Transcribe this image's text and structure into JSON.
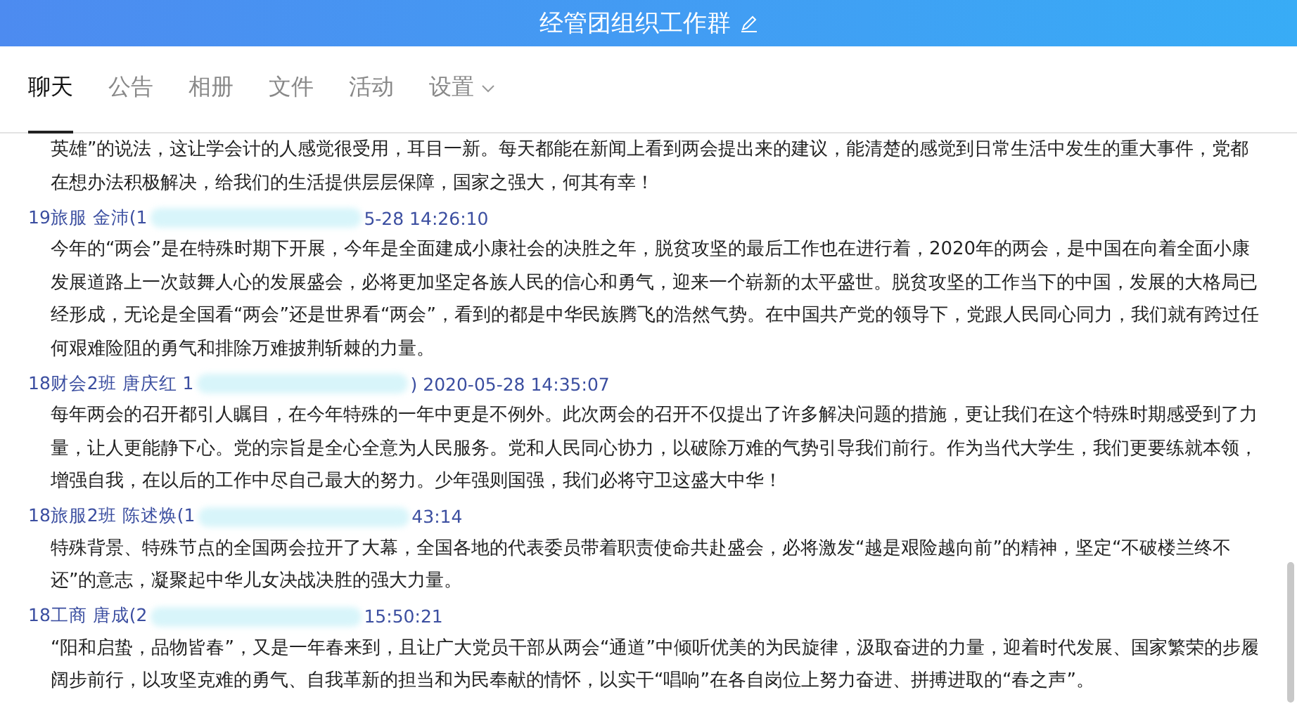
{
  "window": {
    "title": "经管团组织工作群"
  },
  "tabs": [
    {
      "label": "聊天",
      "selected": true
    },
    {
      "label": "公告",
      "selected": false
    },
    {
      "label": "相册",
      "selected": false
    },
    {
      "label": "文件",
      "selected": false
    },
    {
      "label": "活动",
      "selected": false
    },
    {
      "label": "设置",
      "selected": false,
      "kind": "dropdown"
    }
  ],
  "messages": [
    {
      "text": "英雄”的说法，这让学会计的人感觉很受用，耳目一新。每天都能在新闻上看到两会提出来的建议，能清楚的感觉到日常生活中发生的重大事件，党都在想办法积极解决，给我们的生活提供层层保障，国家之强大，何其有幸！"
    },
    {
      "sender": "19旅服 金沛(1",
      "time": "5-28 14:26:10",
      "text": "今年的“两会”是在特殊时期下开展，今年是全面建成小康社会的决胜之年，脱贫攻坚的最后工作也在进行着，2020年的两会，是中国在向着全面小康发展道路上一次鼓舞人心的发展盛会，必将更加坚定各族人民的信心和勇气，迎来一个崭新的太平盛世。脱贫攻坚的工作当下的中国，发展的大格局已经形成，无论是全国看“两会”还是世界看“两会”，看到的都是中华民族腾飞的浩然气势。在中国共产党的领导下，党跟人民同心同力，我们就有跨过任何艰难险阻的勇气和排除万难披荆斩棘的力量。"
    },
    {
      "sender": "18财会2班 唐庆红  1",
      "time": ") 2020-05-28 14:35:07",
      "text": "每年两会的召开都引人瞩目，在今年特殊的一年中更是不例外。此次两会的召开不仅提出了许多解决问题的措施，更让我们在这个特殊时期感受到了力量，让人更能静下心。党的宗旨是全心全意为人民服务。党和人民同心协力，以破除万难的气势引导我们前行。作为当代大学生，我们更要练就本领，增强自我，在以后的工作中尽自己最大的努力。少年强则国强，我们必将守卫这盛大中华！"
    },
    {
      "sender": "18旅服2班 陈述焕(1",
      "time": "43:14",
      "text": "特殊背景、特殊节点的全国两会拉开了大幕，全国各地的代表委员带着职责使命共赴盛会，必将激发“越是艰险越向前”的精神，坚定“不破楼兰终不还”的意志，凝聚起中华儿女决战决胜的强大力量。"
    },
    {
      "sender": "18工商  唐成(2",
      "time": "15:50:21",
      "text": "“阳和启蛰，品物皆春”，又是一年春来到，且让广大党员干部从两会“通道”中倾听优美的为民旋律，汲取奋进的力量，迎着时代发展、国家繁荣的步履阔步前行，以攻坚克难的勇气、自我革新的担当和为民奉献的情怀，以实干“唱响”在各自岗位上努力奋进、拼搏进取的“春之声”。"
    }
  ]
}
